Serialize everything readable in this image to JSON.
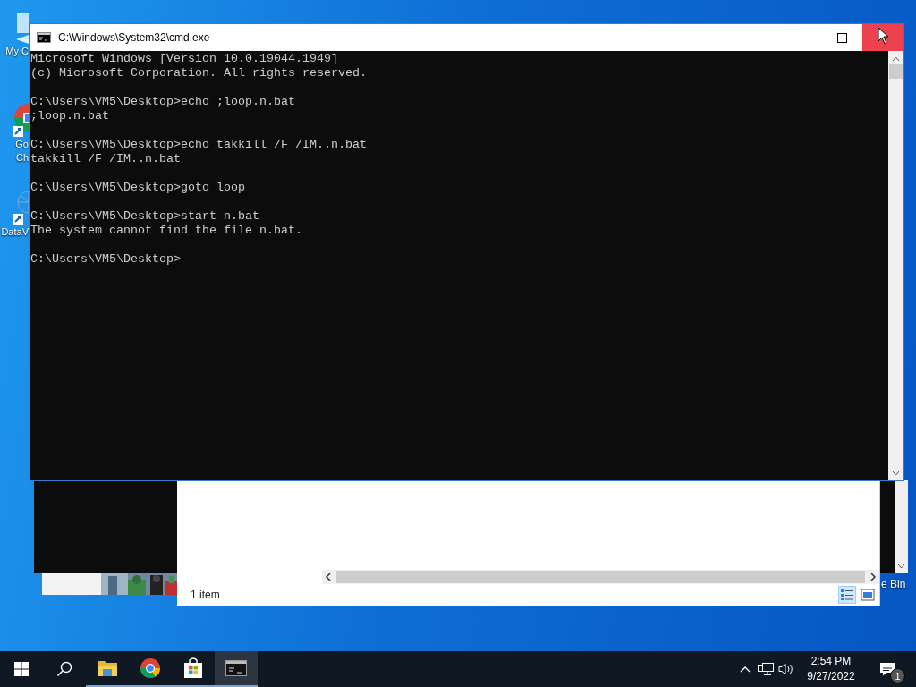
{
  "desktop_icons": [
    {
      "kind": "computer",
      "labels": [
        "My C"
      ]
    },
    {
      "kind": "chrome",
      "labels": [
        "Go",
        "Ch"
      ]
    },
    {
      "kind": "network",
      "labels": [
        "DataV"
      ]
    },
    {
      "kind": "bin",
      "labels": [
        "e Bin"
      ]
    }
  ],
  "console_window": {
    "title": "C:\\Windows\\System32\\cmd.exe",
    "blocks": [
      [
        "Microsoft Windows [Version 10.0.19044.1949]",
        "(c) Microsoft Corporation. All rights reserved."
      ],
      [
        "C:\\Users\\VM5\\Desktop>echo ;loop.n.bat",
        ";loop.n.bat"
      ],
      [
        "C:\\Users\\VM5\\Desktop>echo takkill /F /IM..n.bat",
        "takkill /F /IM..n.bat"
      ],
      [
        "C:\\Users\\VM5\\Desktop>goto loop"
      ],
      [
        "C:\\Users\\VM5\\Desktop>start n.bat",
        "The system cannot find the file n.bat."
      ],
      [
        "C:\\Users\\VM5\\Desktop>"
      ]
    ]
  },
  "explorer_window": {
    "status": "1 item",
    "views": [
      {
        "kind": "details",
        "selected": true
      },
      {
        "kind": "thumbnails",
        "selected": false
      }
    ]
  },
  "taskbar": {
    "apps": [
      {
        "kind": "folder",
        "selected": false
      },
      {
        "kind": "chrome",
        "selected": false
      },
      {
        "kind": "store",
        "selected": false
      },
      {
        "kind": "terminal",
        "selected": true
      }
    ],
    "time": "2:54 PM",
    "date": "9/27/2022",
    "notification_count": "1"
  }
}
